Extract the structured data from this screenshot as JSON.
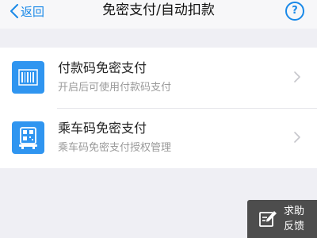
{
  "nav": {
    "back_label": "返回",
    "title": "免密支付/自动扣款",
    "help_label": "?"
  },
  "items": [
    {
      "title": "付款码免密支付",
      "subtitle": "开启后可使用付款码支付",
      "icon": "barcode-icon",
      "chevron": "chevron-right-icon"
    },
    {
      "title": "乘车码免密支付",
      "subtitle": "乘车码免密支付授权管理",
      "icon": "bus-qr-icon",
      "chevron": "chevron-right-icon"
    }
  ],
  "feedback": {
    "line1": "求助",
    "line2": "反馈",
    "icon": "edit-icon"
  },
  "colors": {
    "accent": "#1a89e8",
    "icon_bg": "#2f95f0",
    "page_bg": "#efeff4",
    "card_bg": "#ffffff",
    "subtitle": "#9a9a9a",
    "feedback_bg": "#4d4d4d"
  }
}
